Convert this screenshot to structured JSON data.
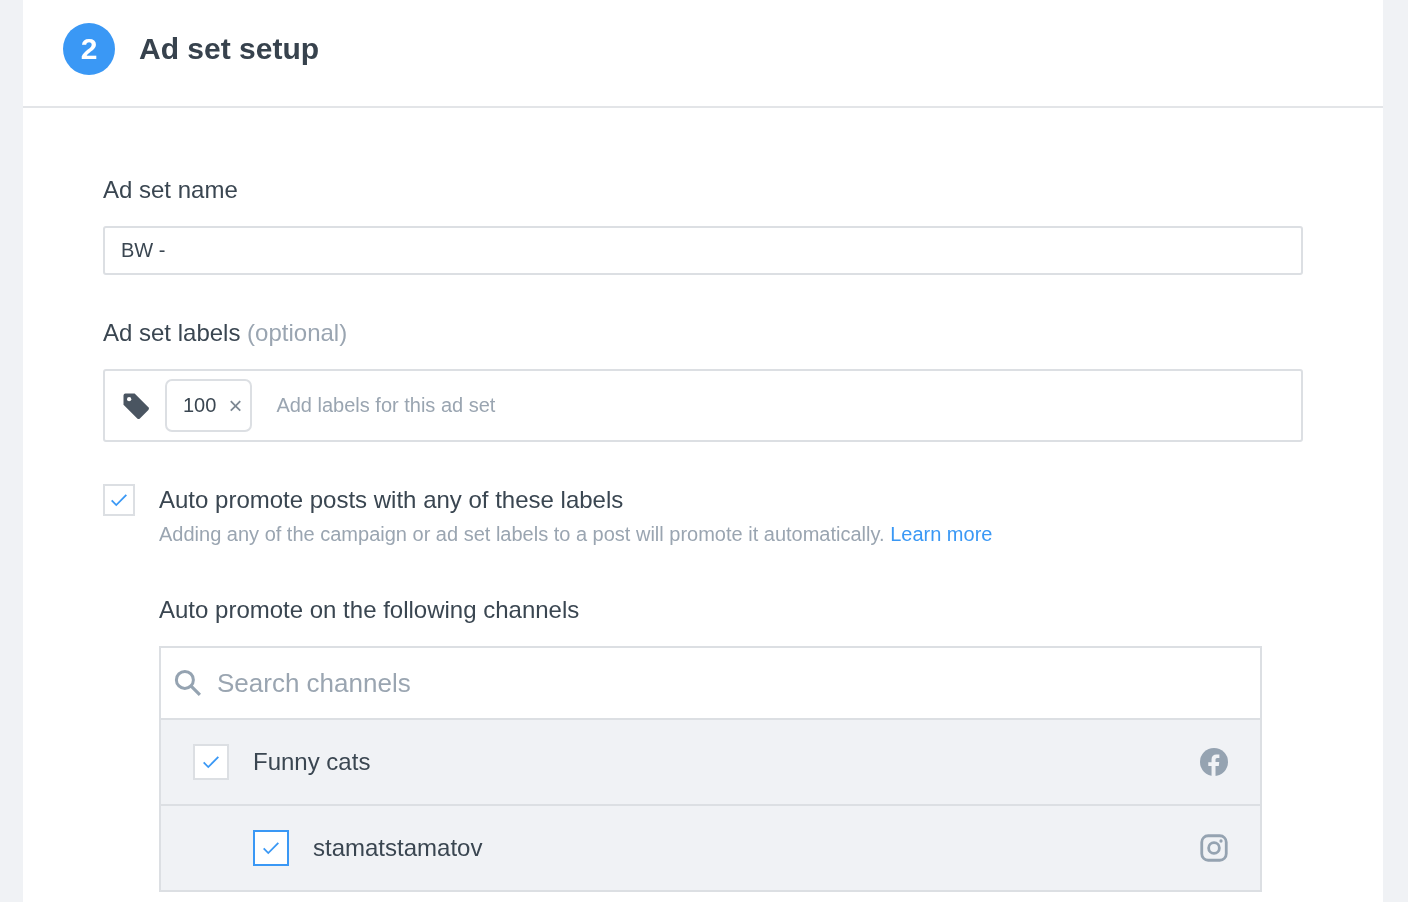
{
  "step": {
    "number": "2",
    "title": "Ad set setup"
  },
  "name_field": {
    "label": "Ad set name",
    "value": "BW -"
  },
  "labels_field": {
    "label": "Ad set labels",
    "label_note": "(optional)",
    "tags": [
      {
        "text": "100",
        "remove": "×"
      }
    ],
    "placeholder": "Add labels for this ad set"
  },
  "auto_promote": {
    "checked": true,
    "title": "Auto promote posts with any of these labels",
    "description": "Adding any of the campaign or ad set labels to a post will promote it automatically.",
    "link": "Learn more"
  },
  "channels": {
    "label": "Auto promote on the following channels",
    "search_placeholder": "Search channels",
    "items": [
      {
        "name": "Funny cats",
        "kind": "facebook",
        "checked": true,
        "focused": false,
        "children": [
          {
            "name": "stamatstamatov",
            "kind": "instagram",
            "checked": true,
            "focused": true
          }
        ]
      }
    ]
  }
}
